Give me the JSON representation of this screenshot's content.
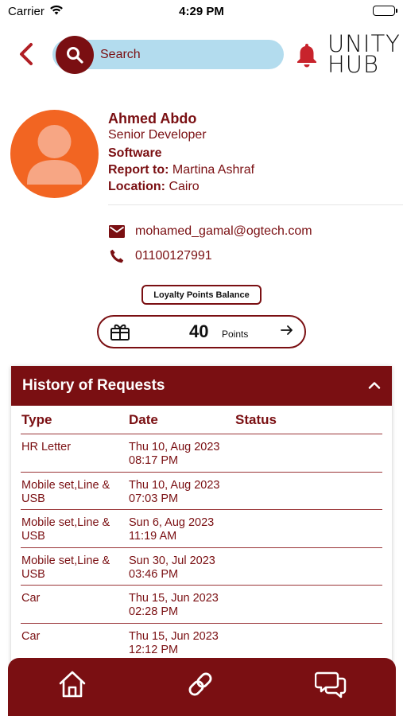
{
  "status_bar": {
    "carrier": "Carrier",
    "time": "4:29 PM"
  },
  "header": {
    "search_placeholder": "Search",
    "brand_line1": "UNITY",
    "brand_line2": "HUB"
  },
  "profile": {
    "name": "Ahmed Abdo",
    "title": "Senior Developer",
    "department": "Software",
    "report_label": "Report to:",
    "report_value": "Martina Ashraf",
    "location_label": "Location:",
    "location_value": "Cairo",
    "email": "mohamed_gamal@ogtech.com",
    "phone": "01100127991"
  },
  "loyalty": {
    "label": "Loyalty Points Balance",
    "points": "40",
    "unit": "Points"
  },
  "history": {
    "title": "History of Requests",
    "columns": [
      "Type",
      "Date",
      "Status"
    ],
    "rows": [
      {
        "type": "HR Letter",
        "date": "Thu 10, Aug 2023 08:17 PM",
        "status": ""
      },
      {
        "type": "Mobile set,Line & USB",
        "date": "Thu 10, Aug 2023 07:03 PM",
        "status": ""
      },
      {
        "type": "Mobile set,Line & USB",
        "date": "Sun 6, Aug 2023 11:19 AM",
        "status": ""
      },
      {
        "type": "Mobile set,Line & USB",
        "date": "Sun 30, Jul 2023 03:46 PM",
        "status": ""
      },
      {
        "type": "Car",
        "date": "Thu 15, Jun 2023 02:28 PM",
        "status": ""
      },
      {
        "type": "Car",
        "date": "Thu 15, Jun 2023 12:12 PM",
        "status": ""
      }
    ]
  },
  "bottom_nav": {
    "items": [
      "home-icon",
      "link-icon",
      "chat-icon"
    ]
  },
  "colors": {
    "primary": "#7a0f12",
    "search_bg": "#b3dcee",
    "avatar_bg": "#f26522"
  }
}
